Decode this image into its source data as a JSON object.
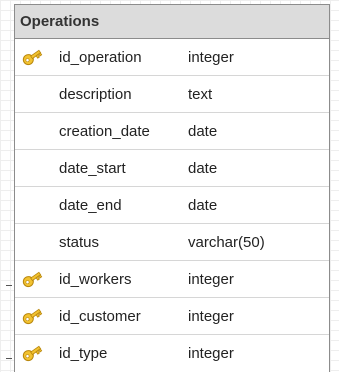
{
  "table": {
    "title": "Operations",
    "columns": [
      {
        "name": "id_operation",
        "type": "integer",
        "key": true
      },
      {
        "name": "description",
        "type": "text",
        "key": false
      },
      {
        "name": "creation_date",
        "type": "date",
        "key": false
      },
      {
        "name": "date_start",
        "type": "date",
        "key": false
      },
      {
        "name": "date_end",
        "type": "date",
        "key": false
      },
      {
        "name": "status",
        "type": "varchar(50)",
        "key": false
      },
      {
        "name": "id_workers",
        "type": "integer",
        "key": true
      },
      {
        "name": "id_customer",
        "type": "integer",
        "key": true
      },
      {
        "name": "id_type",
        "type": "integer",
        "key": true
      }
    ]
  },
  "icons": {
    "key": "key-icon"
  },
  "colors": {
    "header_bg": "#dcdcdc",
    "border": "#8c8c8c",
    "key_icon": "#f2c230"
  }
}
